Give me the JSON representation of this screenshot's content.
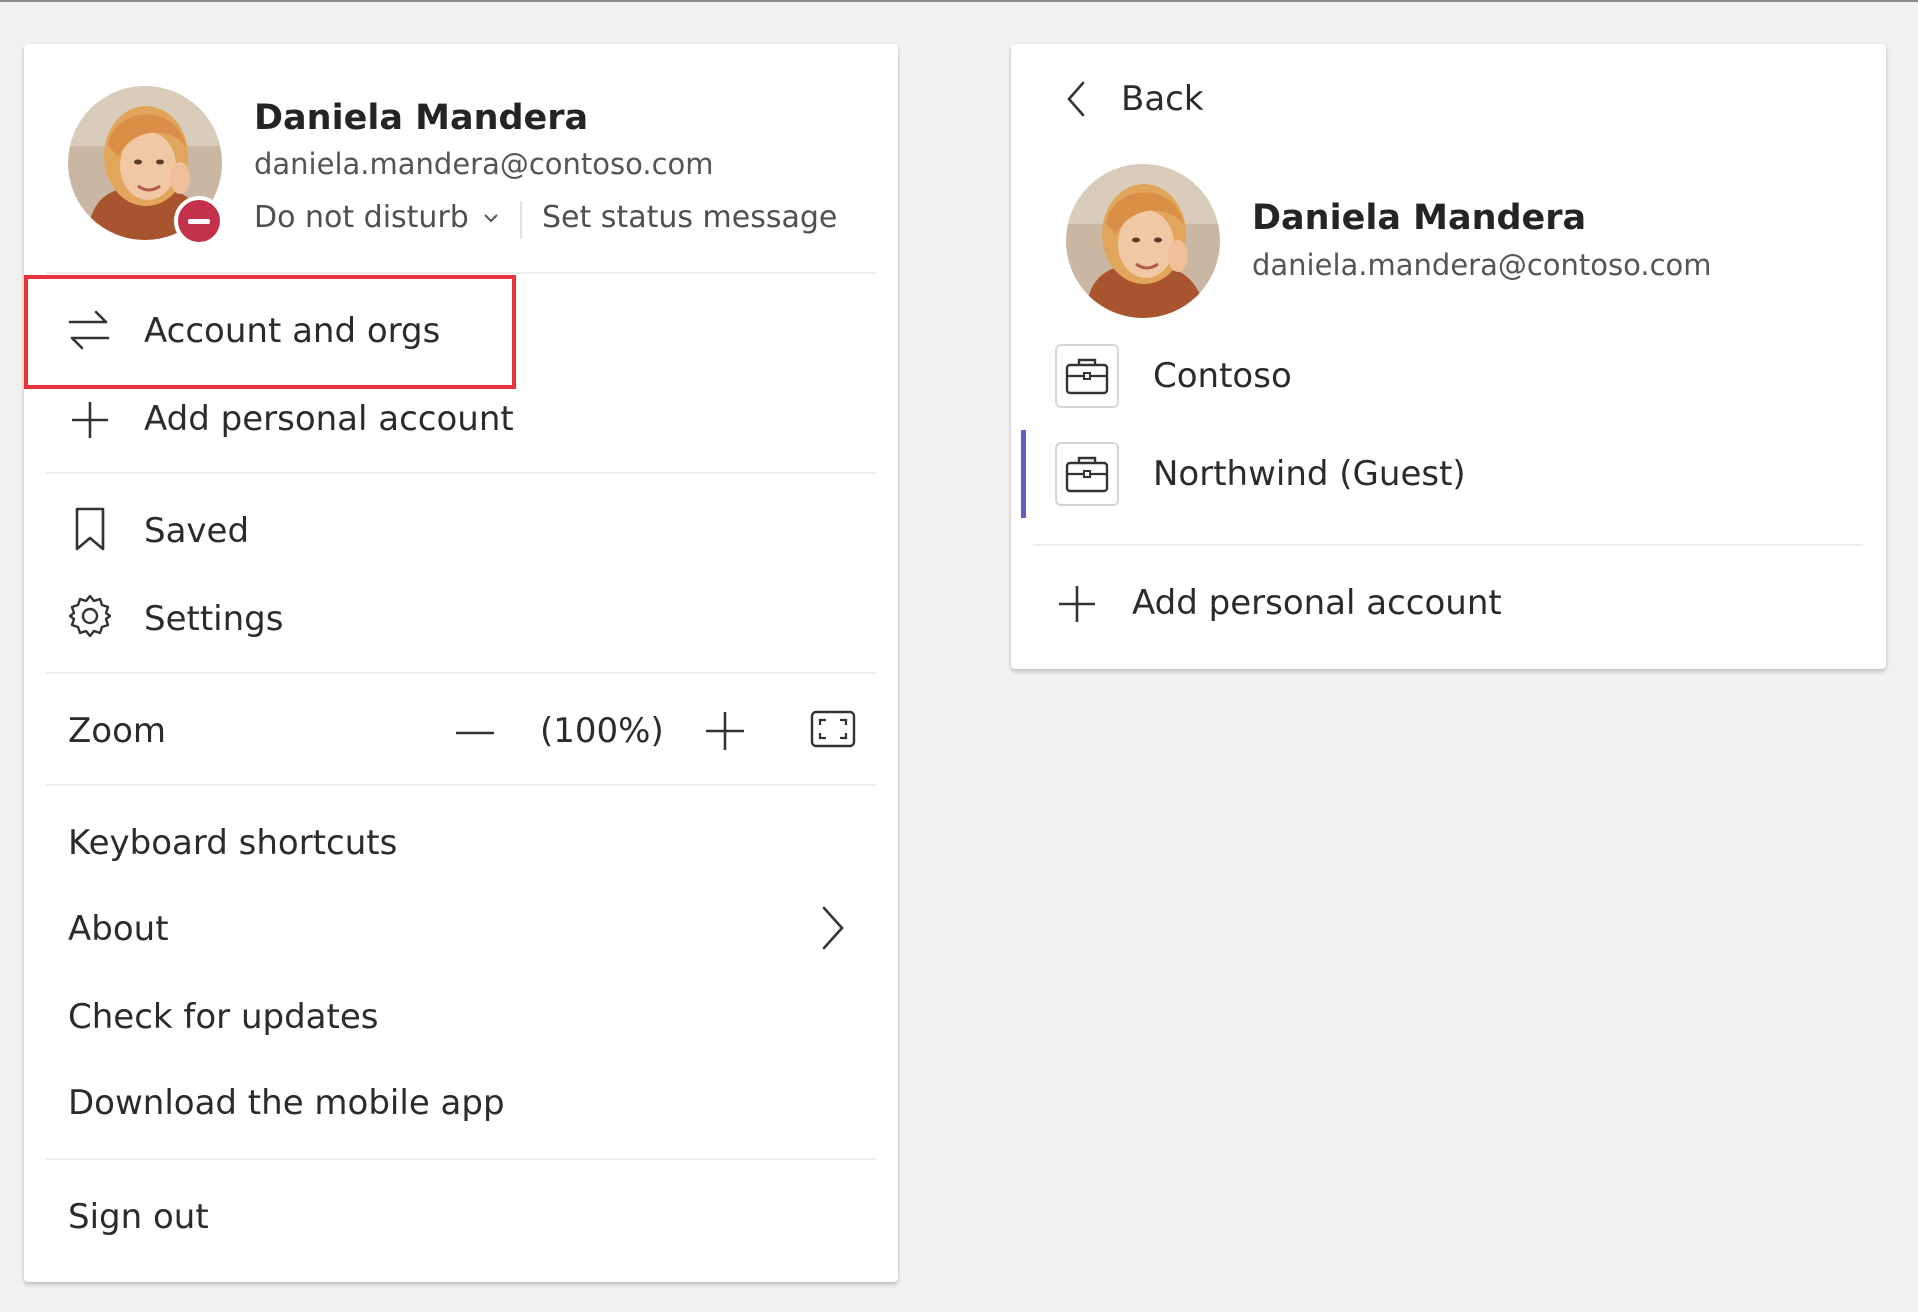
{
  "menu": {
    "user_name": "Daniela Mandera",
    "user_email": "daniela.mandera@contoso.com",
    "status_label": "Do not disturb",
    "set_status_label": "Set status message",
    "account_and_orgs_label": "Account and orgs",
    "add_personal_account_label": "Add personal account",
    "saved_label": "Saved",
    "settings_label": "Settings",
    "zoom_label": "Zoom",
    "zoom_value": "(100%)",
    "keyboard_shortcuts_label": "Keyboard shortcuts",
    "about_label": "About",
    "check_updates_label": "Check for updates",
    "download_mobile_label": "Download the mobile app",
    "sign_out_label": "Sign out"
  },
  "accounts": {
    "back_label": "Back",
    "user_name": "Daniela Mandera",
    "user_email": "daniela.mandera@contoso.com",
    "orgs": [
      {
        "name": "Contoso",
        "active": false
      },
      {
        "name": "Northwind (Guest)",
        "active": true
      }
    ],
    "add_personal_account_label": "Add personal account"
  },
  "colors": {
    "status_dnd": "#c4314b",
    "highlight": "#e8343f",
    "active_indicator": "#5b5fc7",
    "background": "#f2f1f0"
  },
  "icons": {
    "switch": "arrows-swap-icon",
    "add": "plus-icon",
    "saved": "bookmark-icon",
    "settings": "gear-icon",
    "zoom_out": "minus-icon",
    "zoom_in": "plus-icon",
    "fullscreen": "fullscreen-icon",
    "about": "chevron-right-icon",
    "back": "chevron-left-icon",
    "org": "briefcase-icon"
  }
}
